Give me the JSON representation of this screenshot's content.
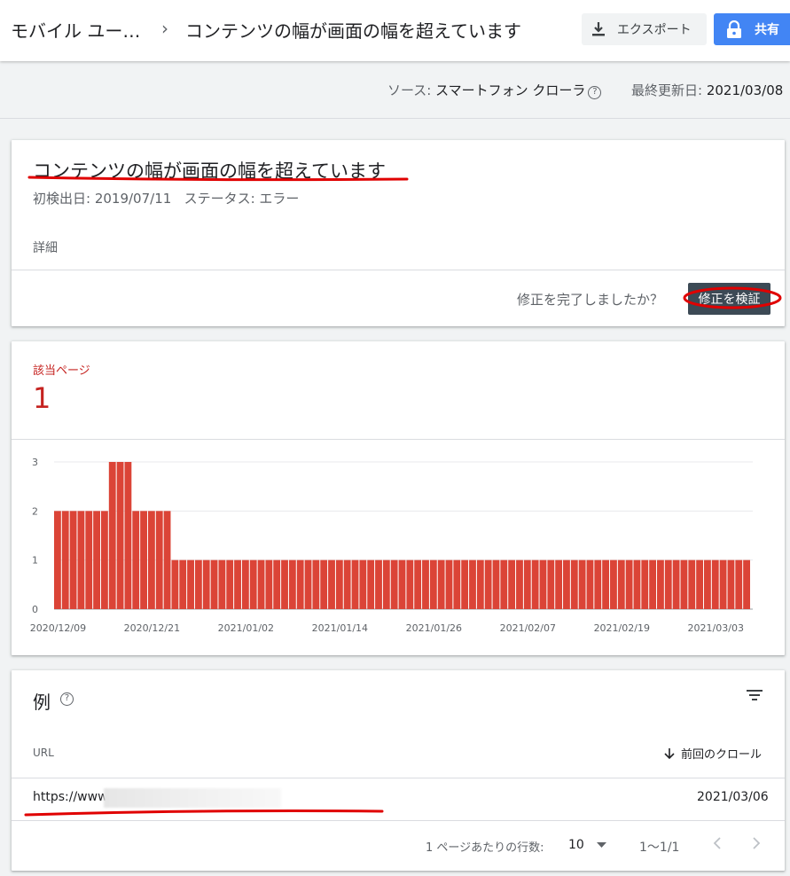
{
  "header": {
    "breadcrumb_parent": "モバイル ユー…",
    "breadcrumb_sep": "›",
    "title": "コンテンツの幅が画面の幅を超えています",
    "export_label": "エクスポート",
    "share_label": "共有",
    "export_icon": "download-icon",
    "share_icon": "lock-icon"
  },
  "source": {
    "label": "ソース: ",
    "value": "スマートフォン クローラ",
    "updated_label": "最終更新日: ",
    "updated_value": "2021/03/08"
  },
  "issue": {
    "title": "コンテンツの幅が画面の幅を超えています",
    "first_detected": "初検出日: 2019/07/11",
    "status": "ステータス: エラー",
    "details_label": "詳細",
    "fix_question": "修正を完了しましたか？",
    "validate_label": "修正を検証"
  },
  "affected": {
    "label": "該当ページ",
    "value": "1"
  },
  "chart_data": {
    "type": "bar",
    "title": "",
    "xlabel": "",
    "ylabel": "",
    "ylim": [
      0,
      3
    ],
    "yticks": [
      "0",
      "1",
      "2",
      "3"
    ],
    "xtick_labels": [
      "2020/12/09",
      "2020/12/21",
      "2021/01/02",
      "2021/01/14",
      "2021/01/26",
      "2021/02/07",
      "2021/02/19",
      "2021/03/03"
    ],
    "x_start": "2020/12/09",
    "x_end": "2021/03/07",
    "values": [
      2,
      2,
      2,
      2,
      2,
      2,
      2,
      3,
      3,
      3,
      2,
      2,
      2,
      2,
      2,
      1,
      1,
      1,
      1,
      1,
      1,
      1,
      1,
      1,
      1,
      1,
      1,
      1,
      1,
      1,
      1,
      1,
      1,
      1,
      1,
      1,
      1,
      1,
      1,
      1,
      1,
      1,
      1,
      1,
      1,
      1,
      1,
      1,
      1,
      1,
      1,
      1,
      1,
      1,
      1,
      1,
      1,
      1,
      1,
      1,
      1,
      1,
      1,
      1,
      1,
      1,
      1,
      1,
      1,
      1,
      1,
      1,
      1,
      1,
      1,
      1,
      1,
      1,
      1,
      1,
      1,
      1,
      1,
      1,
      1,
      1,
      1,
      1,
      1
    ],
    "grid": true,
    "color": "#db4437"
  },
  "examples": {
    "title": "例",
    "col_url": "URL",
    "col_crawl": "前回のクロール",
    "rows": [
      {
        "url": "https://www.",
        "date": "2021/03/06"
      }
    ],
    "rows_per_page_label": "1 ページあたりの行数:",
    "rows_per_page": "10",
    "range": "1〜1/1"
  },
  "colors": {
    "accent": "#4285f4",
    "error": "#c5221f",
    "bar": "#db4437",
    "annotation": "#e00000"
  }
}
